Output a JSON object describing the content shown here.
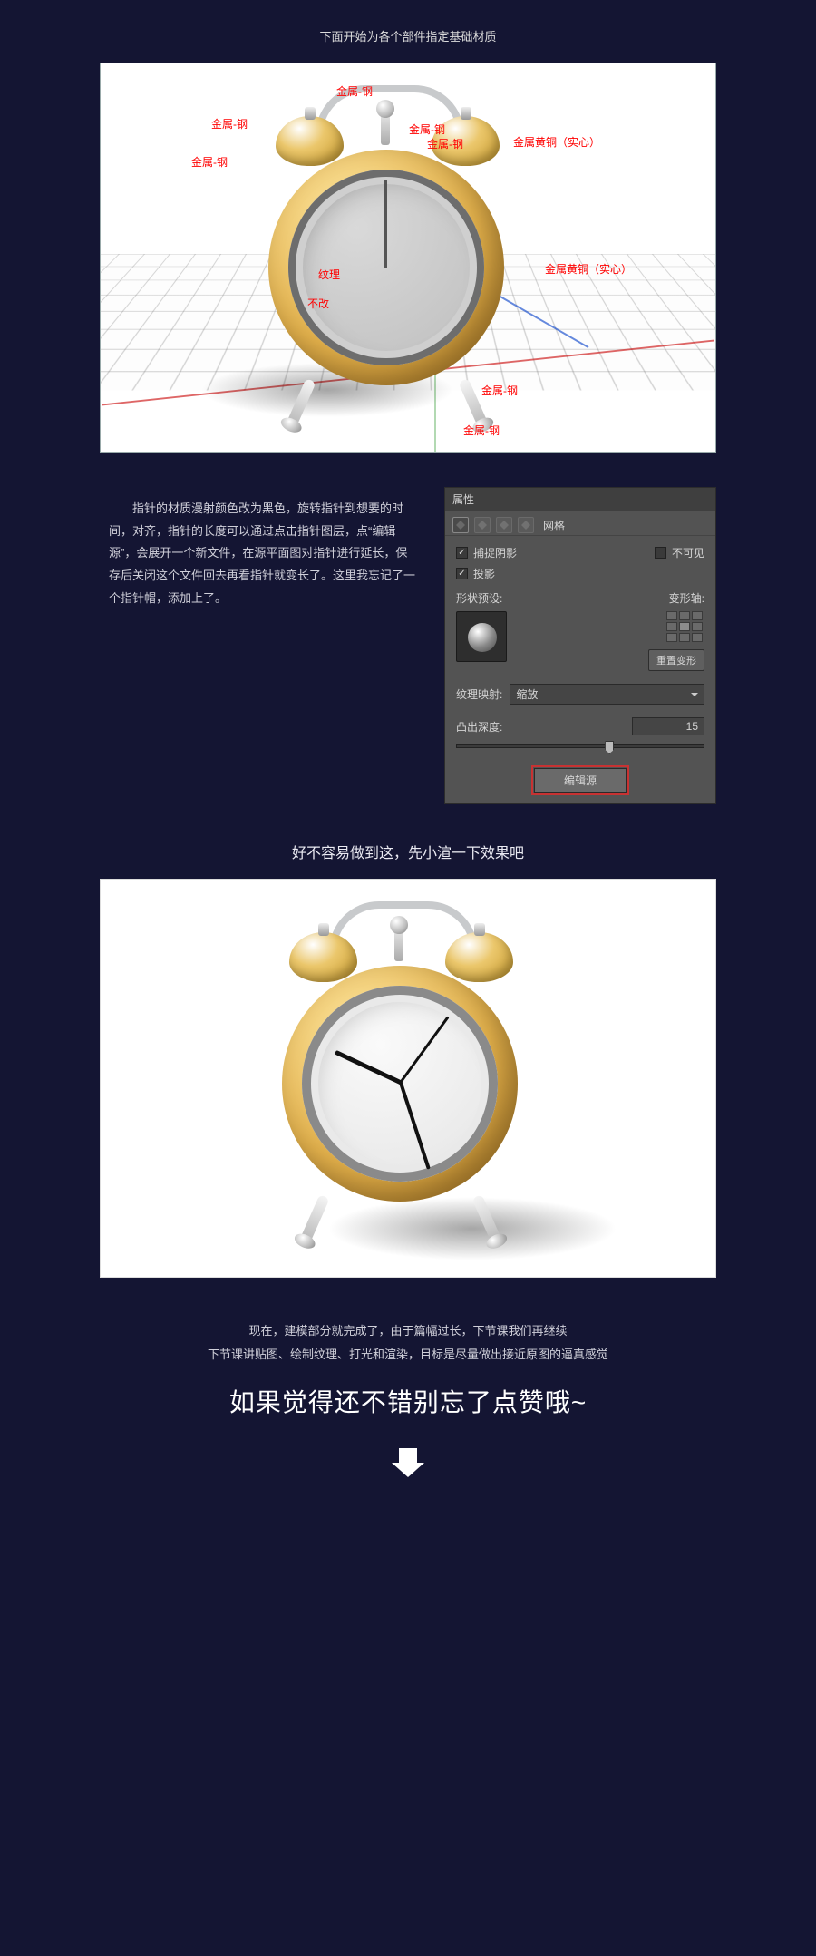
{
  "intro_title": "下面开始为各个部件指定基础材质",
  "annotations": {
    "handle": "金属-钢",
    "bell_left_knob": "金属-钢",
    "bell_right_knob": "金属-钢",
    "hammer": "金属-钢",
    "bell_material": "金属黄铜（实心）",
    "bell_left": "金属-钢",
    "body_material": "金属黄铜（实心）",
    "face_texture": "纹理",
    "face_unchanged": "不改",
    "leg_right": "金属-钢",
    "foot_right": "金属-钢"
  },
  "paragraph": "指针的材质漫射颜色改为黑色，旋转指针到想要的时间，对齐，指针的长度可以通过点击指针图层，点“编辑源”，会展开一个新文件，在源平面图对指针进行延长，保存后关闭这个文件回去再看指针就变长了。这里我忘记了一个指针帽，添加上了。",
  "panel": {
    "title": "属性",
    "tab_label": "网格",
    "capture_shadow": "捕捉阴影",
    "invisible": "不可见",
    "cast_shadow": "投影",
    "shape_preset_label": "形状预设:",
    "deform_axis_label": "变形轴:",
    "reset_deform": "重置变形",
    "texture_map_label": "纹理映射:",
    "texture_map_value": "缩放",
    "extrude_label": "凸出深度:",
    "extrude_value": "15",
    "edit_source": "编辑源"
  },
  "mid_title": "好不容易做到这，先小渲一下效果吧",
  "outro_line1": "现在，建模部分就完成了，由于篇幅过长，下节课我们再继续",
  "outro_line2": "下节课讲贴图、绘制纹理、打光和渲染，目标是尽量做出接近原图的逼真感觉",
  "cta": "如果觉得还不错别忘了点赞哦~"
}
